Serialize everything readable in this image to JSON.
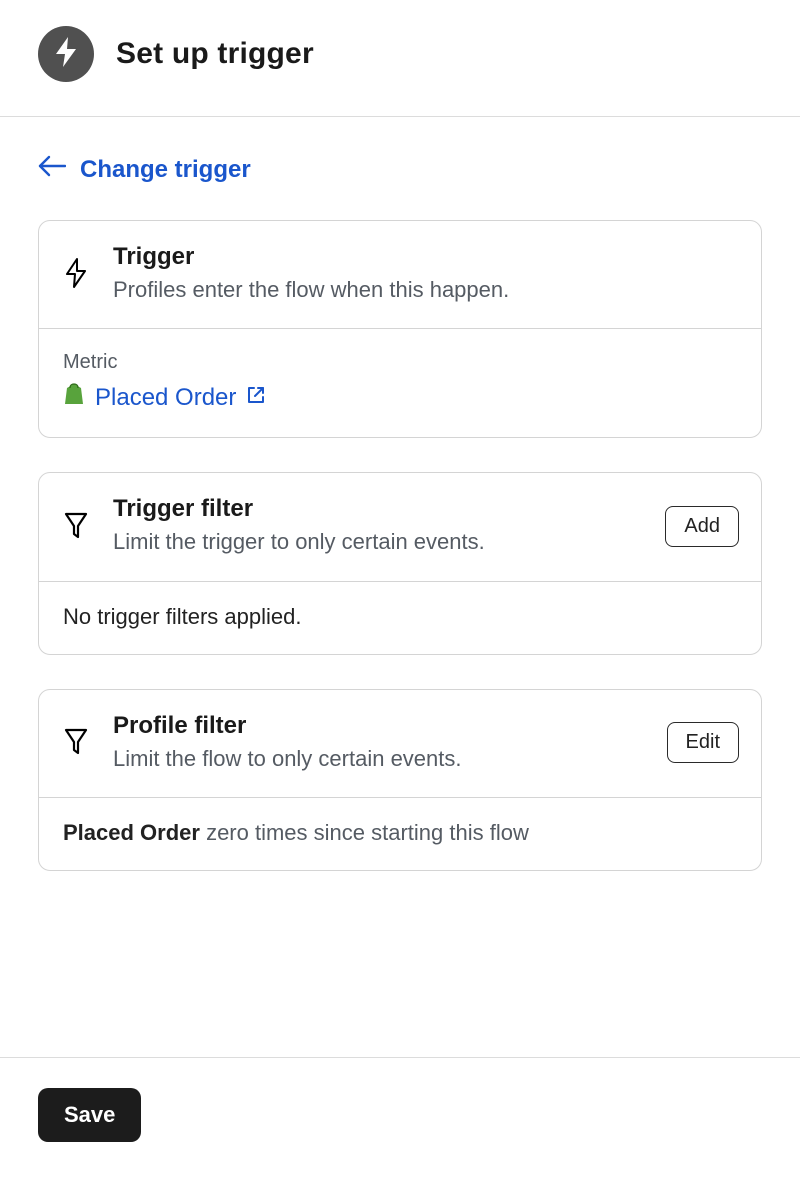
{
  "header": {
    "title": "Set up trigger"
  },
  "back_link": {
    "label": "Change trigger"
  },
  "trigger_card": {
    "title": "Trigger",
    "subtitle": "Profiles enter the flow when this happen.",
    "metric_label": "Metric",
    "metric_value": "Placed Order"
  },
  "trigger_filter_card": {
    "title": "Trigger filter",
    "subtitle": "Limit the trigger to only certain events.",
    "button": "Add",
    "body": "No trigger filters applied."
  },
  "profile_filter_card": {
    "title": "Profile filter",
    "subtitle": "Limit the flow to only certain events.",
    "button": "Edit",
    "body_bold": "Placed Order",
    "body_rest": " zero times since starting this flow"
  },
  "footer": {
    "save": "Save"
  }
}
